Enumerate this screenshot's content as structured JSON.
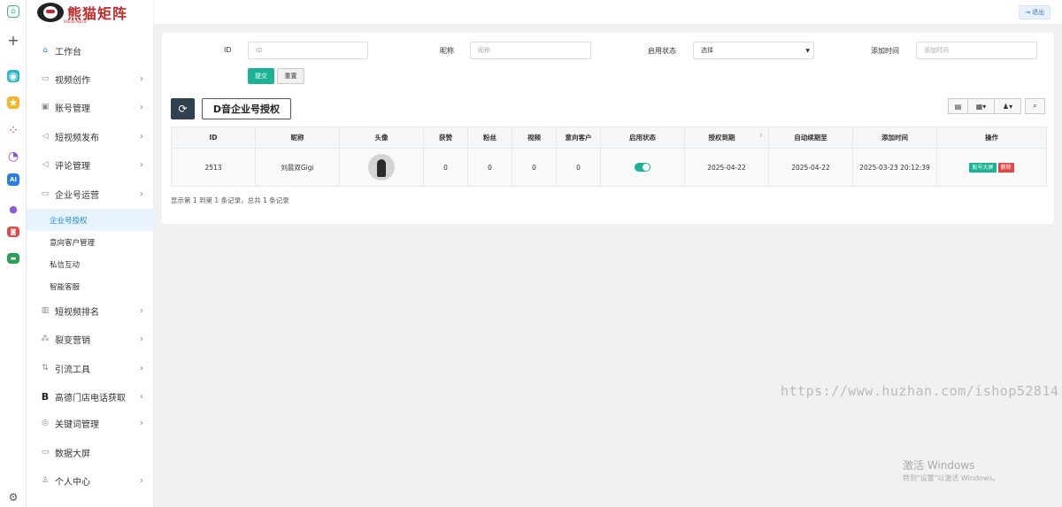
{
  "brand": {
    "name": "熊猫矩阵",
    "sub": "Panda Matrix"
  },
  "topbar": {
    "logout": "退出"
  },
  "sidebar": {
    "items": [
      {
        "icon": "home-icon",
        "glyph": "⌂",
        "label": "工作台",
        "chev": ""
      },
      {
        "icon": "video-icon",
        "glyph": "▭",
        "label": "视频创作",
        "chev": "›"
      },
      {
        "icon": "account-icon",
        "glyph": "▣",
        "label": "账号管理",
        "chev": "›"
      },
      {
        "icon": "send-icon",
        "glyph": "◁",
        "label": "短视频发布",
        "chev": "›"
      },
      {
        "icon": "comment-icon",
        "glyph": "◁",
        "label": "评论管理",
        "chev": "›"
      },
      {
        "icon": "enterprise-icon",
        "glyph": "▭",
        "label": "企业号运营",
        "chev": "›"
      }
    ],
    "sub_items": [
      "企业号授权",
      "意向客户管理",
      "私信互动",
      "智能客服"
    ],
    "items2": [
      {
        "icon": "ranking-icon",
        "glyph": "▥",
        "label": "短视频排名",
        "chev": "›"
      },
      {
        "icon": "fission-icon",
        "glyph": "⁂",
        "label": "裂变营销",
        "chev": "›"
      },
      {
        "icon": "traffic-icon",
        "glyph": "⇅",
        "label": "引流工具",
        "chev": "›"
      },
      {
        "icon": "gaode-icon",
        "glyph": "B",
        "label": "高德门店电话获取",
        "chev": "‹"
      },
      {
        "icon": "keyword-icon",
        "glyph": "◎",
        "label": "关键词管理",
        "chev": "›"
      },
      {
        "icon": "dashboard-icon",
        "glyph": "▭",
        "label": "数据大屏",
        "chev": ""
      },
      {
        "icon": "user-icon",
        "glyph": "♙",
        "label": "个人中心",
        "chev": "›"
      }
    ]
  },
  "filters": {
    "id_label": "ID",
    "id_placeholder": "ID",
    "nick_label": "昵称",
    "nick_placeholder": "昵称",
    "status_label": "启用状态",
    "status_value": "选择",
    "time_label": "添加时间",
    "time_placeholder": "添加时间",
    "submit": "提交",
    "reset": "重置"
  },
  "toolbar": {
    "title": "D音企业号授权"
  },
  "table": {
    "headers": [
      "ID",
      "昵称",
      "头像",
      "获赞",
      "粉丝",
      "视频",
      "意向客户",
      "启用状态",
      "授权到期",
      "自动续期至",
      "添加时间",
      "操作"
    ],
    "rows": [
      {
        "id": "2513",
        "nick": "刘晨双Gigi",
        "likes": "0",
        "fans": "0",
        "videos": "0",
        "leads": "0",
        "enabled": true,
        "expire": "2025-04-22",
        "renew": "2025-04-22",
        "added": "2025-03-23 20:12:39",
        "btn1": "账号大屏",
        "btn2": "删除"
      }
    ]
  },
  "pager": "显示第 1 到第 1 条记录，总共 1 条记录",
  "watermark": "https://www.huzhan.com/ishop52814",
  "windows": {
    "line1": "激活 Windows",
    "line2": "转到\"设置\"以激活 Windows。"
  },
  "colors": {
    "accent": "#1bb394",
    "primary": "#1e88e5",
    "danger": "#e04848",
    "dark": "#2f4050"
  }
}
